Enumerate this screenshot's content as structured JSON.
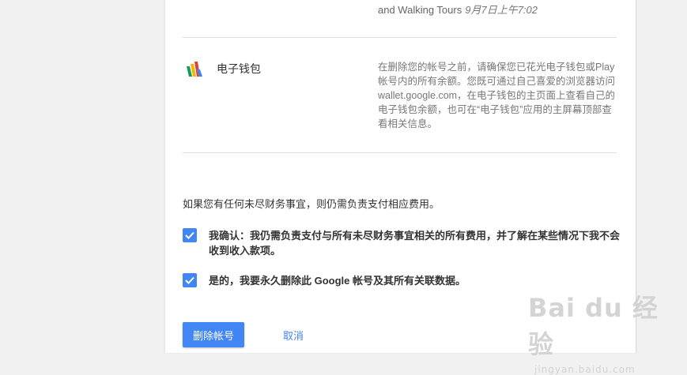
{
  "previous_item": {
    "text": "and Walking Tours",
    "timestamp": "9月7日上午7:02"
  },
  "service": {
    "icon": "google-wallet-icon",
    "name": "电子钱包",
    "description": "在删除您的帐号之前，请确保您已花光电子钱包或Play 帐号内的所有余额。您既可通过自己喜爱的浏览器访问 wallet.google.com，在电子钱包的主页面上查看自己的电子钱包余额，也可在“电子钱包”应用的主屏幕顶部查看相关信息。"
  },
  "notice": "如果您有任何未尽财务事宜，则仍需负责支付相应费用。",
  "confirmations": [
    {
      "label": "我确认：我仍需负责支付与所有未尽财务事宜相关的所有费用，并了解在某些情况下我不会收到收入款项。",
      "checked": true
    },
    {
      "label": "是的，我要永久删除此 Google 帐号及其所有关联数据。",
      "checked": true
    }
  ],
  "buttons": {
    "delete_label": "删除帐号",
    "cancel_label": "取消"
  },
  "watermark": {
    "brand": "Bai du 经验",
    "url": "jingyan.baidu.com"
  },
  "colors": {
    "accent": "#4285f4",
    "background": "#f1f1f1"
  }
}
